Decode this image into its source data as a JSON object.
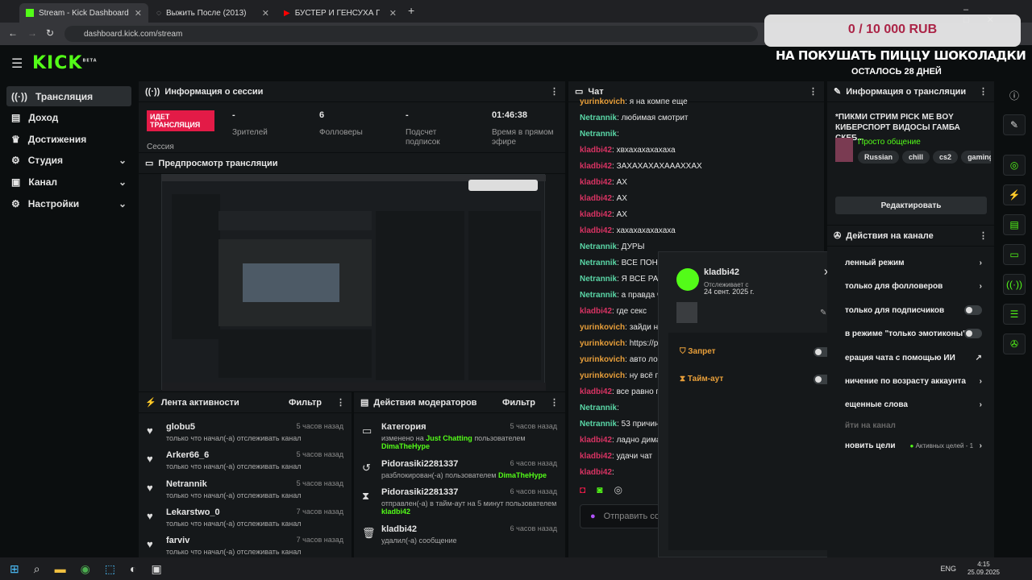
{
  "browser": {
    "tabs": [
      {
        "label": "Stream - Kick Dashboard",
        "active": true
      },
      {
        "label": "Выжить После (2013)",
        "active": false
      },
      {
        "label": "БУСТЕР И ГЕНСУХА ПОМ",
        "active": false
      }
    ],
    "url": "dashboard.kick.com/stream"
  },
  "logo": "KICK",
  "logo_beta": "BETA",
  "overlay": {
    "goal": "0 / 10 000 RUB",
    "title": "НА ПОКУШАТЬ ПИЦЦУ ШОКОЛАДКИ",
    "sub": "ОСТАЛОСЬ 28 ДНЕЙ"
  },
  "sidebar": {
    "items": [
      {
        "label": "Трансляция",
        "icon": "broadcast-icon"
      },
      {
        "label": "Доход",
        "icon": "wallet-icon"
      },
      {
        "label": "Достижения",
        "icon": "trophy-icon"
      },
      {
        "label": "Студия",
        "icon": "gear-icon"
      },
      {
        "label": "Канал",
        "icon": "channel-icon"
      },
      {
        "label": "Настройки",
        "icon": "settings-icon"
      }
    ]
  },
  "session": {
    "title": "Информация о сессии",
    "live_badge": "ИДЕТ ТРАНСЛЯЦИЯ",
    "session_label": "Сессия",
    "stats": [
      {
        "value": "-",
        "label": "Зрителей"
      },
      {
        "value": "6",
        "label": "Фолловеры"
      },
      {
        "value": "-",
        "label": "Подсчет подписок"
      },
      {
        "value": "01:46:38",
        "label": "Время в прямом эфире"
      }
    ]
  },
  "preview": {
    "title": "Предпросмотр трансляции"
  },
  "activity": {
    "title": "Лента активности",
    "filter": "Фильтр",
    "items": [
      {
        "name": "globu5",
        "desc": "только что начал(-а) отслеживать канал",
        "time": "5 часов назад"
      },
      {
        "name": "Arker66_6",
        "desc": "только что начал(-а) отслеживать канал",
        "time": "5 часов назад"
      },
      {
        "name": "Netrannik",
        "desc": "только что начал(-а) отслеживать канал",
        "time": "5 часов назад"
      },
      {
        "name": "Lekarstwo_0",
        "desc": "только что начал(-а) отслеживать канал",
        "time": "7 часов назад"
      },
      {
        "name": "farviv",
        "desc": "только что начал(-а) отслеживать канал",
        "time": "7 часов назад"
      }
    ]
  },
  "mod": {
    "title": "Действия модераторов",
    "filter": "Фильтр",
    "items": [
      {
        "name": "Категория",
        "line1": "изменено на",
        "hl": "Just Chatting",
        "line2": "пользователем",
        "user": "DimaTheHype",
        "time": "5 часов назад"
      },
      {
        "name": "Pidorasiki2281337",
        "line1": "разблокирован(-а) пользователем",
        "user": "DimaTheHype",
        "time": "6 часов назад"
      },
      {
        "name": "Pidorasiki2281337",
        "line1": "отправлен(-а) в тайм-аут на 5 минут пользователем",
        "user": "kladbi42",
        "time": "6 часов назад"
      },
      {
        "name": "kladbi42",
        "line1": "удалил(-а) сообщение",
        "user": "",
        "time": "6 часов назад"
      }
    ]
  },
  "chat": {
    "title": "Чат",
    "lines": [
      {
        "user": "yurinkovich",
        "c": "o",
        "msg": ": я на компе еще"
      },
      {
        "user": "Netrannik",
        "c": "t",
        "msg": ": любимая смотрит"
      },
      {
        "user": "Netrannik",
        "c": "t",
        "msg": ":"
      },
      {
        "user": "kladbi42",
        "c": "r",
        "msg": ": хвхахахахахаха"
      },
      {
        "user": "kladbi42",
        "c": "r",
        "msg": ": ЗАХАХАХАХАААХХАХ"
      },
      {
        "user": "kladbi42",
        "c": "r",
        "msg": ": АХ"
      },
      {
        "user": "kladbi42",
        "c": "r",
        "msg": ": АХ"
      },
      {
        "user": "kladbi42",
        "c": "r",
        "msg": ": АХ"
      },
      {
        "user": "kladbi42",
        "c": "r",
        "msg": ": хахахахахахаха"
      },
      {
        "user": "Netrannik",
        "c": "t",
        "msg": ": ДУРЫ"
      },
      {
        "user": "Netrannik",
        "c": "t",
        "msg": ": ВСЕ ПОНЯТ"
      },
      {
        "user": "Netrannik",
        "c": "t",
        "msg": ": Я ВСЕ РАСС"
      },
      {
        "user": "Netrannik",
        "c": "t",
        "msg": ": а правда чт"
      },
      {
        "user": "kladbi42",
        "c": "r",
        "msg": ": где секс"
      },
      {
        "user": "yurinkovich",
        "c": "o",
        "msg": ": зайди на с"
      },
      {
        "user": "yurinkovich",
        "c": "o",
        "msg": ": https://pik"
      },
      {
        "user": "yurinkovich",
        "c": "o",
        "msg": ": авто логи"
      },
      {
        "user": "yurinkovich",
        "c": "o",
        "msg": ": ну всё пок"
      },
      {
        "user": "kladbi42",
        "c": "r",
        "msg": ": все равно п"
      },
      {
        "user": "Netrannik",
        "c": "t",
        "msg": ":"
      },
      {
        "user": "Netrannik",
        "c": "t",
        "msg": ": 53 причины"
      },
      {
        "user": "kladbi42",
        "c": "r",
        "msg": ": ладно дима т"
      },
      {
        "user": "kladbi42",
        "c": "r",
        "msg": ": удачи чат"
      },
      {
        "user": "kladbi42",
        "c": "r",
        "msg": ":"
      }
    ],
    "input_placeholder": "Отправить со"
  },
  "popup": {
    "user": "kladbi42",
    "following_label": "Отслеживает с",
    "following_date": "24 сент. 2025 г.",
    "ban": "Запрет",
    "timeout": "Тайм-аут"
  },
  "stream_info": {
    "title": "Информация о трансляции",
    "stream_title": "*ПИКМИ СТРИМ PICK ME BOY КИБЕРСПОРТ ВИДОСЫ ГАМБА СКЕБ...",
    "category": "Просто общение",
    "tags": [
      "Russian",
      "chill",
      "cs2",
      "gaming",
      "c"
    ],
    "edit": "Редактировать"
  },
  "channel_actions": {
    "title": "Действия на канале",
    "rows": [
      {
        "label": "ленный режим",
        "ctrl": "arrow"
      },
      {
        "label": "только для фолловеров",
        "ctrl": "arrow"
      },
      {
        "label": "только для подписчиков",
        "ctrl": "toggle"
      },
      {
        "label": "в режиме \"только эмотиконы\"",
        "ctrl": "toggle"
      },
      {
        "label": "ерация чата с помощью ИИ",
        "ctrl": "ext"
      },
      {
        "label": "ничение по возрасту аккаунта",
        "ctrl": "arrow"
      },
      {
        "label": "ещенные слова",
        "ctrl": "arrow"
      },
      {
        "label": "йти на канал",
        "ctrl": "none"
      },
      {
        "label": "новить цели",
        "ctrl": "arrow",
        "extra": "Активных целей - 1"
      }
    ]
  },
  "taskbar": {
    "lang": "ENG",
    "time": "4:15",
    "date": "25.09.2025"
  }
}
